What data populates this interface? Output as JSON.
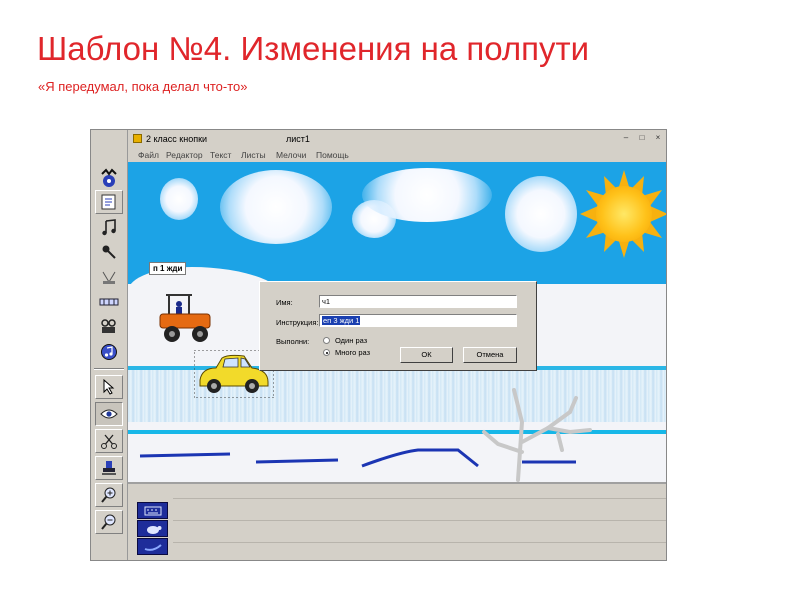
{
  "slide": {
    "title": "Шаблон №4. Изменения на полпути",
    "subtitle": "«Я передумал, пока делал что-то»"
  },
  "window": {
    "app_name": "2 класс кнопки",
    "sheet_name": "лист1",
    "buttons": {
      "minimize": "–",
      "maximize": "□",
      "close": "×"
    },
    "menu": [
      "Файл",
      "Редактор",
      "Текст",
      "Листы",
      "Мелочи",
      "Помощь"
    ]
  },
  "toolbox": {
    "icons": [
      "character-icon",
      "notes-icon",
      "music-icon",
      "microphone-icon",
      "printer-icon",
      "measure-icon",
      "projector-icon",
      "cd-icon",
      "cursor-icon",
      "eye-icon",
      "scissors-icon",
      "stamp-icon",
      "zoom-in-icon",
      "zoom-out-icon"
    ]
  },
  "canvas": {
    "tag_label": "п 1 жди",
    "colors": {
      "sky": "#1ca3e6",
      "snow": "#f3f4f8",
      "river_line": "#16b7e8",
      "road": "#1b35b3",
      "tractor": "#e56a12",
      "car": "#f2da2a"
    }
  },
  "dialog": {
    "name_label": "Имя:",
    "name_value": "ч1",
    "instruction_label": "Инструкция:",
    "instruction_value": "еп 3 жди 1",
    "execute_label": "Выполни:",
    "option_once": "Один раз",
    "option_many": "Много раз",
    "selected_option": "Много раз",
    "ok_label": "ОК",
    "cancel_label": "Отмена"
  },
  "bottom_panel": {
    "icons": [
      "keyboard-icon",
      "turtle-icon",
      "sled-icon"
    ]
  }
}
